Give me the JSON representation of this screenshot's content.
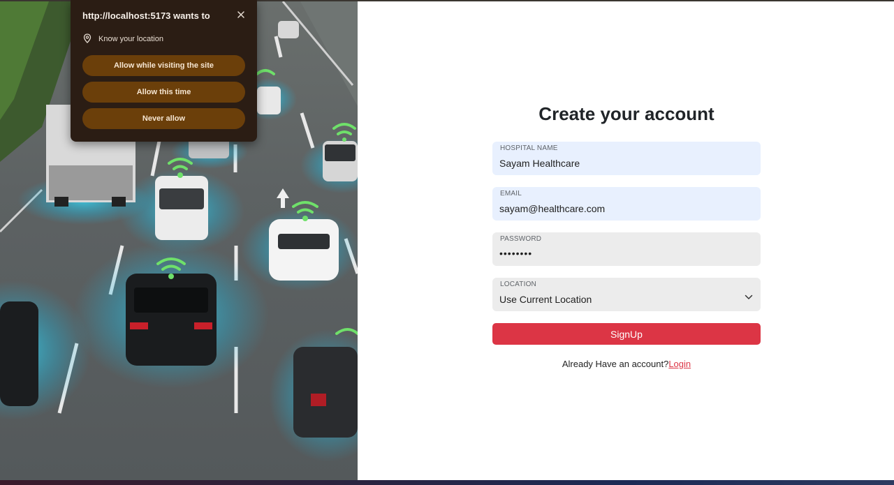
{
  "permission_prompt": {
    "title": "http://localhost:5173 wants to",
    "request": "Know your location",
    "icons": {
      "location": "location-pin-icon",
      "close": "close-icon"
    },
    "buttons": {
      "allow_while_visiting": "Allow while visiting the site",
      "allow_this_time": "Allow this time",
      "never_allow": "Never allow"
    },
    "colors": {
      "background": "#2b1d14",
      "button": "#6b3f0a"
    }
  },
  "form": {
    "title": "Create your account",
    "hospital_name": {
      "label": "HOSPITAL NAME",
      "value": "Sayam Healthcare"
    },
    "email": {
      "label": "EMAIL",
      "value": "sayam@healthcare.com"
    },
    "password": {
      "label": "PASSWORD",
      "value": "••••••••"
    },
    "location": {
      "label": "LOCATION",
      "value": "Use Current Location",
      "icon": "chevron-down-icon"
    },
    "signup_label": "SignUp",
    "already_text": "Already Have an account?",
    "login_link": "Login",
    "colors": {
      "accent": "#dc3545",
      "autofill": "#e8f0fe",
      "field": "#ececec"
    }
  }
}
